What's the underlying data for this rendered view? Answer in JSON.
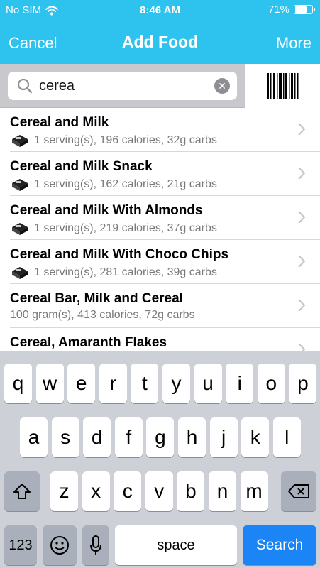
{
  "status": {
    "carrier": "No SIM",
    "time": "8:46 AM",
    "battery": "71%",
    "battery_level": 0.71
  },
  "nav": {
    "cancel": "Cancel",
    "title": "Add Food",
    "more": "More"
  },
  "search": {
    "query": "cerea"
  },
  "colors": {
    "header": "#2ec2ef",
    "search_key": "#1b85f6"
  },
  "results": [
    {
      "name": "Cereal and Milk",
      "detail": "1 serving(s), 196 calories, 32g carbs",
      "icon": "food-tray-icon"
    },
    {
      "name": "Cereal and Milk Snack",
      "detail": "1 serving(s), 162 calories, 21g carbs",
      "icon": "food-tray-icon"
    },
    {
      "name": "Cereal and Milk With Almonds",
      "detail": "1 serving(s), 219 calories, 37g carbs",
      "icon": "food-tray-icon"
    },
    {
      "name": "Cereal and Milk With Choco Chips",
      "detail": "1 serving(s), 281 calories, 39g carbs",
      "icon": "food-tray-icon"
    },
    {
      "name": "Cereal Bar, Milk and Cereal",
      "detail": "100 gram(s), 413 calories, 72g carbs",
      "icon": ""
    },
    {
      "name": "Cereal, Amaranth Flakes",
      "detail": "",
      "icon": ""
    }
  ],
  "keyboard": {
    "row1": [
      "q",
      "w",
      "e",
      "r",
      "t",
      "y",
      "u",
      "i",
      "o",
      "p"
    ],
    "row2": [
      "a",
      "s",
      "d",
      "f",
      "g",
      "h",
      "j",
      "k",
      "l"
    ],
    "row3": [
      "z",
      "x",
      "c",
      "v",
      "b",
      "n",
      "m"
    ],
    "numbers": "123",
    "space": "space",
    "search": "Search"
  }
}
